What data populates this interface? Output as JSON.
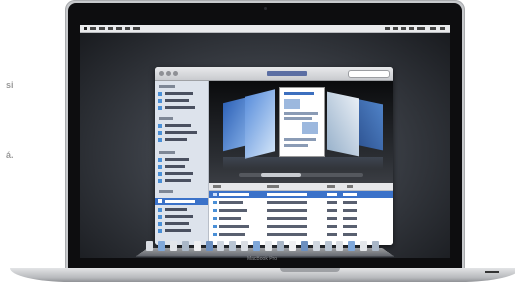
{
  "side_text": {
    "line1": "si",
    "line2": "á."
  },
  "laptop": {
    "model_label": "MacBook Pro"
  },
  "finder": {
    "view_mode": "cover-flow",
    "selected_sidebar_index": 9,
    "selected_list_row": 1
  },
  "dock": {
    "icon_count": 20
  },
  "colors": {
    "selection": "#3b72c9",
    "desktop": "#3b3f46",
    "aluminum": "#c7c9cc"
  }
}
